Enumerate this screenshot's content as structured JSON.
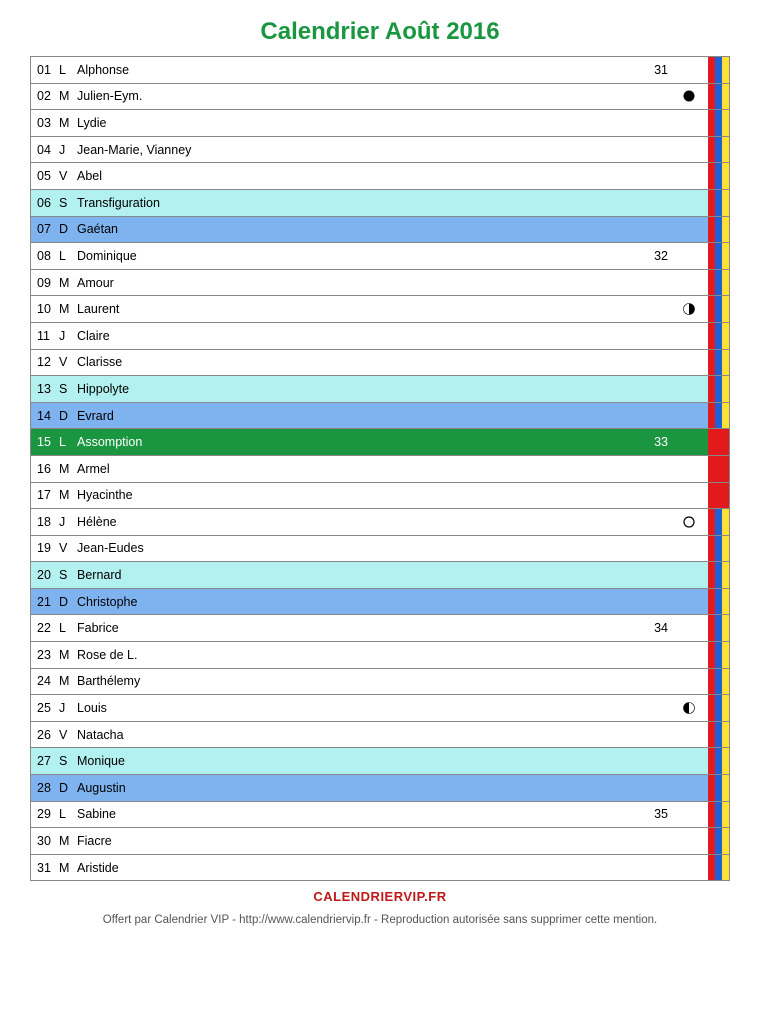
{
  "title": "Calendrier Août 2016",
  "footer_brand": "CALENDRIERVIP.FR",
  "footer_note": "Offert par Calendrier VIP - http://www.calendriervip.fr - Reproduction autorisée sans supprimer cette mention.",
  "colors": {
    "title": "#1a9641",
    "saturday_bg": "#b3f0f0",
    "sunday_bg": "#7fb3f0",
    "holiday_bg": "#1a9641",
    "stripe_red": "#e31a1c",
    "stripe_blue": "#1f60d8",
    "stripe_yellow": "#ffe135",
    "stripe_green": "#1a9641"
  },
  "days": [
    {
      "num": "01",
      "dow": "L",
      "saint": "Alphonse",
      "week": "31",
      "moon": "",
      "type": "weekday",
      "stripes": [
        "red",
        "blue",
        "yellow"
      ]
    },
    {
      "num": "02",
      "dow": "M",
      "saint": "Julien-Eym.",
      "week": "",
      "moon": "new",
      "type": "weekday",
      "stripes": [
        "red",
        "blue",
        "yellow"
      ]
    },
    {
      "num": "03",
      "dow": "M",
      "saint": "Lydie",
      "week": "",
      "moon": "",
      "type": "weekday",
      "stripes": [
        "red",
        "blue",
        "yellow"
      ]
    },
    {
      "num": "04",
      "dow": "J",
      "saint": "Jean-Marie, Vianney",
      "week": "",
      "moon": "",
      "type": "weekday",
      "stripes": [
        "red",
        "blue",
        "yellow"
      ]
    },
    {
      "num": "05",
      "dow": "V",
      "saint": "Abel",
      "week": "",
      "moon": "",
      "type": "weekday",
      "stripes": [
        "red",
        "blue",
        "yellow"
      ]
    },
    {
      "num": "06",
      "dow": "S",
      "saint": "Transfiguration",
      "week": "",
      "moon": "",
      "type": "saturday",
      "stripes": [
        "red",
        "blue",
        "yellow"
      ]
    },
    {
      "num": "07",
      "dow": "D",
      "saint": "Gaétan",
      "week": "",
      "moon": "",
      "type": "sunday",
      "stripes": [
        "red",
        "blue",
        "yellow"
      ]
    },
    {
      "num": "08",
      "dow": "L",
      "saint": "Dominique",
      "week": "32",
      "moon": "",
      "type": "weekday",
      "stripes": [
        "red",
        "blue",
        "yellow"
      ]
    },
    {
      "num": "09",
      "dow": "M",
      "saint": "Amour",
      "week": "",
      "moon": "",
      "type": "weekday",
      "stripes": [
        "red",
        "blue",
        "yellow"
      ]
    },
    {
      "num": "10",
      "dow": "M",
      "saint": "Laurent",
      "week": "",
      "moon": "first",
      "type": "weekday",
      "stripes": [
        "red",
        "blue",
        "yellow"
      ]
    },
    {
      "num": "11",
      "dow": "J",
      "saint": "Claire",
      "week": "",
      "moon": "",
      "type": "weekday",
      "stripes": [
        "red",
        "blue",
        "yellow"
      ]
    },
    {
      "num": "12",
      "dow": "V",
      "saint": "Clarisse",
      "week": "",
      "moon": "",
      "type": "weekday",
      "stripes": [
        "red",
        "blue",
        "yellow"
      ]
    },
    {
      "num": "13",
      "dow": "S",
      "saint": "Hippolyte",
      "week": "",
      "moon": "",
      "type": "saturday",
      "stripes": [
        "red",
        "blue",
        "yellow"
      ]
    },
    {
      "num": "14",
      "dow": "D",
      "saint": "Evrard",
      "week": "",
      "moon": "",
      "type": "sunday",
      "stripes": [
        "red",
        "blue",
        "yellow"
      ]
    },
    {
      "num": "15",
      "dow": "L",
      "saint": "Assomption",
      "week": "33",
      "moon": "",
      "type": "holiday",
      "stripes": [
        "red",
        "red",
        "red"
      ]
    },
    {
      "num": "16",
      "dow": "M",
      "saint": "Armel",
      "week": "",
      "moon": "",
      "type": "weekday",
      "stripes": [
        "red",
        "red",
        "red"
      ]
    },
    {
      "num": "17",
      "dow": "M",
      "saint": "Hyacinthe",
      "week": "",
      "moon": "",
      "type": "weekday",
      "stripes": [
        "red",
        "red",
        "red"
      ]
    },
    {
      "num": "18",
      "dow": "J",
      "saint": "Hélène",
      "week": "",
      "moon": "full",
      "type": "weekday",
      "stripes": [
        "red",
        "blue",
        "yellow"
      ]
    },
    {
      "num": "19",
      "dow": "V",
      "saint": "Jean-Eudes",
      "week": "",
      "moon": "",
      "type": "weekday",
      "stripes": [
        "red",
        "blue",
        "yellow"
      ]
    },
    {
      "num": "20",
      "dow": "S",
      "saint": "Bernard",
      "week": "",
      "moon": "",
      "type": "saturday",
      "stripes": [
        "red",
        "blue",
        "yellow"
      ]
    },
    {
      "num": "21",
      "dow": "D",
      "saint": "Christophe",
      "week": "",
      "moon": "",
      "type": "sunday",
      "stripes": [
        "red",
        "blue",
        "yellow"
      ]
    },
    {
      "num": "22",
      "dow": "L",
      "saint": "Fabrice",
      "week": "34",
      "moon": "",
      "type": "weekday",
      "stripes": [
        "red",
        "blue",
        "yellow"
      ]
    },
    {
      "num": "23",
      "dow": "M",
      "saint": "Rose de L.",
      "week": "",
      "moon": "",
      "type": "weekday",
      "stripes": [
        "red",
        "blue",
        "yellow"
      ]
    },
    {
      "num": "24",
      "dow": "M",
      "saint": "Barthélemy",
      "week": "",
      "moon": "",
      "type": "weekday",
      "stripes": [
        "red",
        "blue",
        "yellow"
      ]
    },
    {
      "num": "25",
      "dow": "J",
      "saint": "Louis",
      "week": "",
      "moon": "last",
      "type": "weekday",
      "stripes": [
        "red",
        "blue",
        "yellow"
      ]
    },
    {
      "num": "26",
      "dow": "V",
      "saint": "Natacha",
      "week": "",
      "moon": "",
      "type": "weekday",
      "stripes": [
        "red",
        "blue",
        "yellow"
      ]
    },
    {
      "num": "27",
      "dow": "S",
      "saint": "Monique",
      "week": "",
      "moon": "",
      "type": "saturday",
      "stripes": [
        "red",
        "blue",
        "yellow"
      ]
    },
    {
      "num": "28",
      "dow": "D",
      "saint": "Augustin",
      "week": "",
      "moon": "",
      "type": "sunday",
      "stripes": [
        "red",
        "blue",
        "yellow"
      ]
    },
    {
      "num": "29",
      "dow": "L",
      "saint": "Sabine",
      "week": "35",
      "moon": "",
      "type": "weekday",
      "stripes": [
        "red",
        "blue",
        "yellow"
      ]
    },
    {
      "num": "30",
      "dow": "M",
      "saint": "Fiacre",
      "week": "",
      "moon": "",
      "type": "weekday",
      "stripes": [
        "red",
        "blue",
        "yellow"
      ]
    },
    {
      "num": "31",
      "dow": "M",
      "saint": "Aristide",
      "week": "",
      "moon": "",
      "type": "weekday",
      "stripes": [
        "red",
        "blue",
        "yellow"
      ]
    }
  ]
}
